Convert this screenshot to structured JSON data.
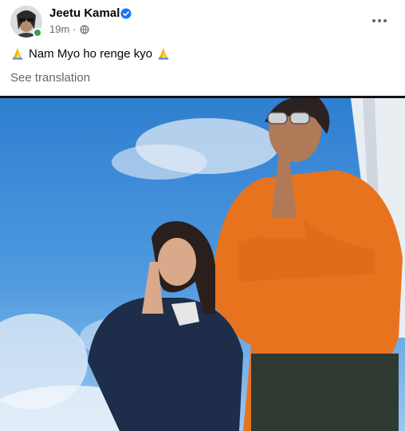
{
  "post": {
    "author": "Jeetu Kamal",
    "time": "19m",
    "text": "Nam Myo ho renge kyo",
    "see_translation": "See translation"
  },
  "icons": {
    "verified": "verified-badge-icon",
    "privacy": "globe-icon",
    "more": "more-options-icon",
    "emoji": "folded-hands-emoji"
  },
  "colors": {
    "verified_blue": "#1877f2",
    "online_green": "#31a24c",
    "secondary_text": "#65676b"
  }
}
